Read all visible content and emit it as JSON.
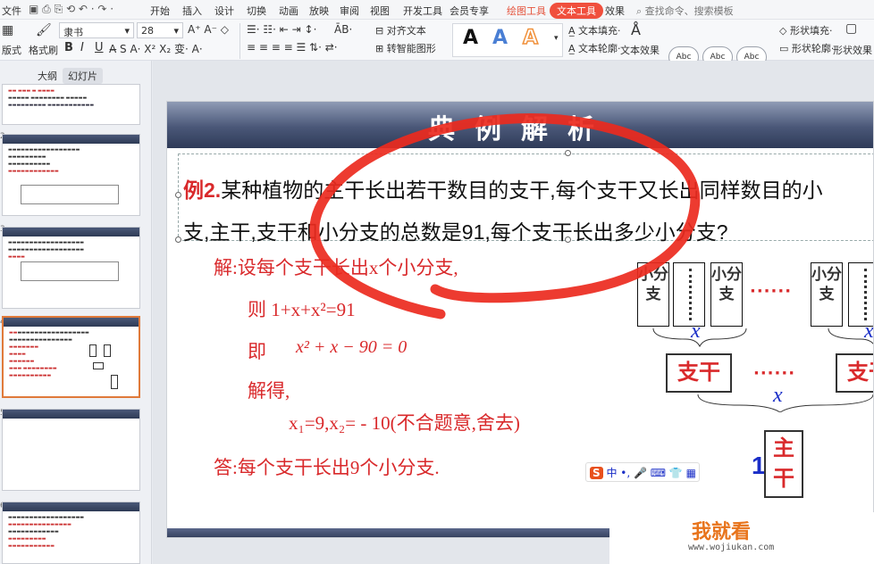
{
  "menubar": {
    "file": "文件",
    "items": [
      "开始",
      "插入",
      "设计",
      "切换",
      "动画",
      "放映",
      "审阅",
      "视图",
      "开发工具",
      "会员专享"
    ],
    "drawing_tools": "绘图工具",
    "text_tools": "文本工具",
    "effects": "效果",
    "search": "查找命令、搜索模板"
  },
  "ribbon": {
    "layout": "版式",
    "format_painter": "格式刷",
    "font_name": "隶书",
    "font_size": "28",
    "bold": "B",
    "italic": "I",
    "underline": "U",
    "align_text": "对齐文本",
    "smart_shape": "转智能图形",
    "text_fill": "文本填充",
    "text_outline": "文本轮廓",
    "text_effects": "文本效果",
    "shape_fill": "形状填充",
    "shape_outline": "形状轮廓",
    "shape_effects": "形状效果",
    "style_sample": "Abc"
  },
  "left_panel": {
    "tab_outline": "大纲",
    "tab_slides": "幻灯片",
    "slide_numbers": [
      "2",
      "3",
      "4",
      "5",
      "6",
      "7"
    ]
  },
  "slide": {
    "banner_title": "典例解析",
    "question_label": "例2.",
    "question_line1": "某种植物的主干长出若干数目的支干,每个支干又长出同样数目的小",
    "question_line2": "支,主干,支干和小分支的总数是91,每个支干长出多少小分支?",
    "sol_1": "解:设每个支干长出x个小分支,",
    "sol_2": "则  1+x+x²=91",
    "sol_3_prefix": "即",
    "sol_3_eq": "x² + x − 90 = 0",
    "sol_4": "解得,",
    "sol_5": "x₁=9,x₂= - 10(不合题意,舍去)",
    "sol_6": "答:每个支干长出9个小分支.",
    "diagram": {
      "small_branch": "小分支",
      "branch": "支干",
      "trunk": "主干",
      "x": "x",
      "one": "1",
      "dots": "······"
    }
  },
  "watermark": {
    "brand": "我就看",
    "url": "www.wojiukan.com"
  }
}
